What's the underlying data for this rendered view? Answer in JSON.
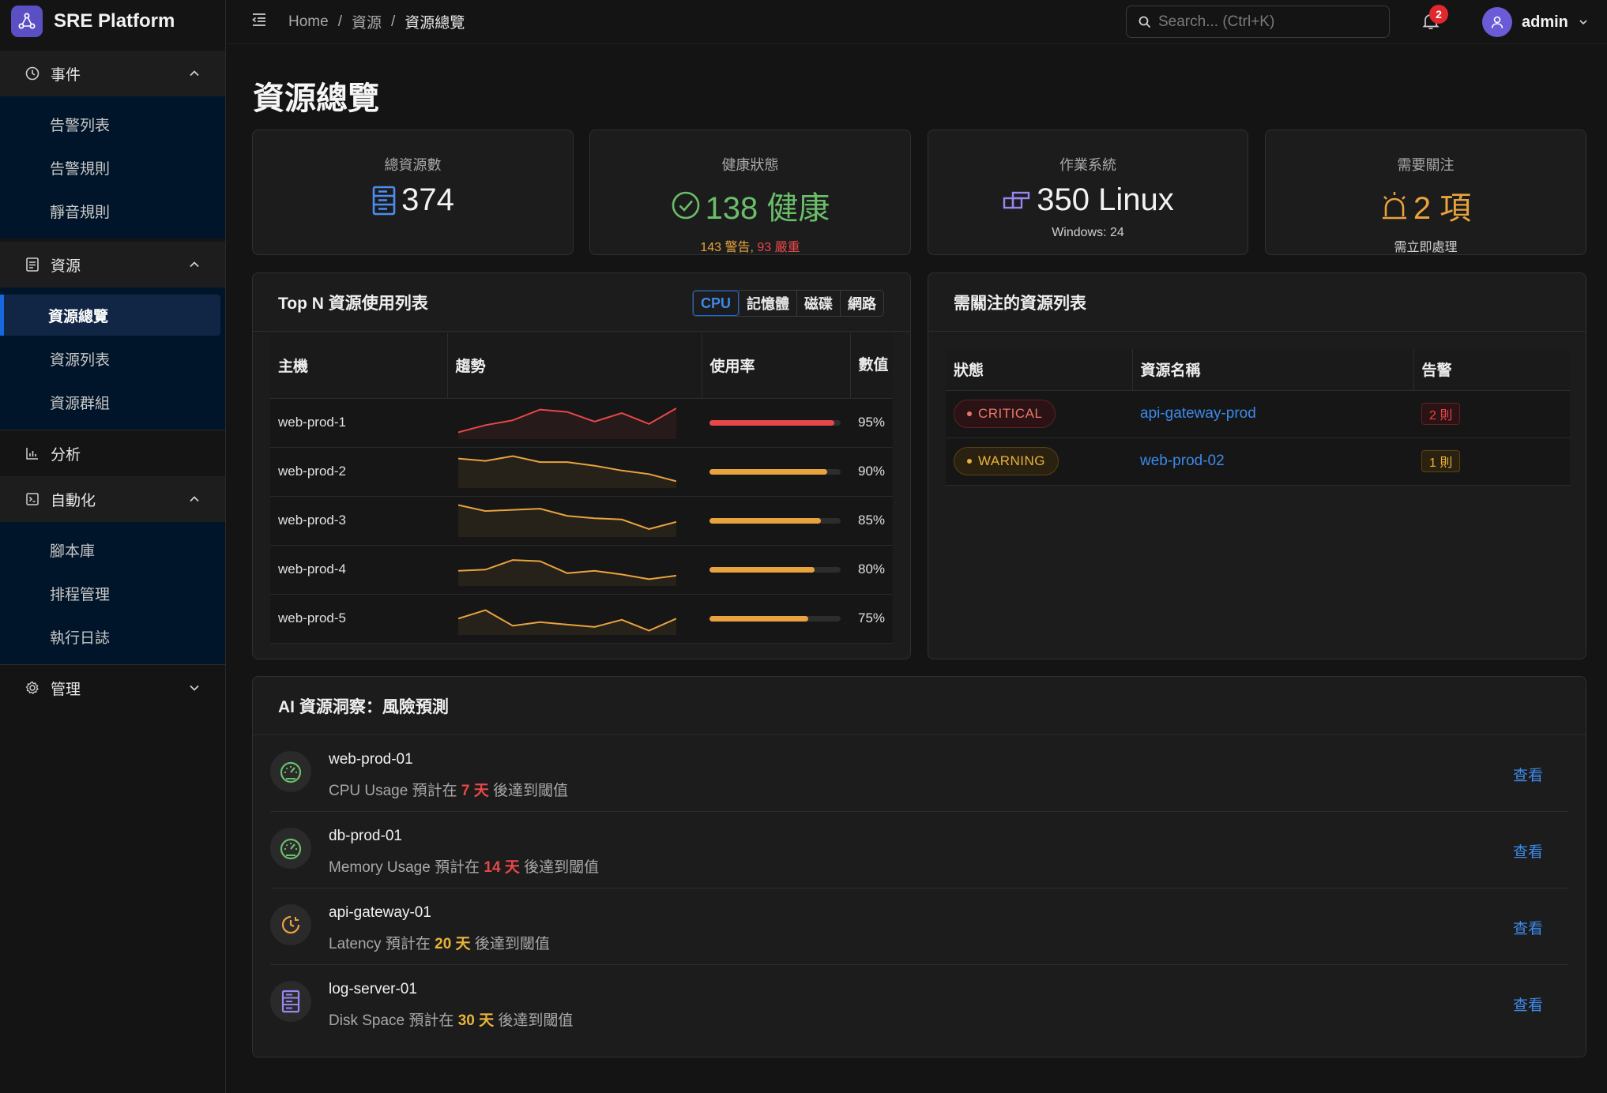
{
  "brand": {
    "name": "SRE Platform"
  },
  "sidebar": {
    "groups": [
      {
        "label": "事件",
        "items": [
          "告警列表",
          "告警規則",
          "靜音規則"
        ]
      },
      {
        "label": "資源",
        "items": [
          "資源總覽",
          "資源列表",
          "資源群組"
        ],
        "active": "資源總覽"
      },
      {
        "label": "分析"
      },
      {
        "label": "自動化",
        "items": [
          "腳本庫",
          "排程管理",
          "執行日誌"
        ]
      },
      {
        "label": "管理"
      }
    ]
  },
  "header": {
    "breadcrumb": [
      "Home",
      "資源",
      "資源總覽"
    ],
    "search_placeholder": "Search... (Ctrl+K)",
    "notification_count": "2",
    "username": "admin"
  },
  "page": {
    "title": "資源總覽"
  },
  "stats": {
    "total": {
      "label": "總資源數",
      "value": "374"
    },
    "health": {
      "label": "健康狀態",
      "value": "138 健康",
      "warn": "143 警告",
      "sep": ",",
      "crit": "93 嚴重"
    },
    "os": {
      "label": "作業系統",
      "value": "350 Linux",
      "sub": "Windows: 24"
    },
    "attention": {
      "label": "需要關注",
      "value": "2 項",
      "sub": "需立即處理"
    }
  },
  "topn": {
    "title": "Top N 資源使用列表",
    "tabs": [
      "CPU",
      "記憶體",
      "磁碟",
      "網路"
    ],
    "active_tab": "CPU",
    "columns": [
      "主機",
      "趨勢",
      "使用率",
      "數值"
    ],
    "rows": [
      {
        "host": "web-prod-1",
        "usage": 95,
        "value": "95%",
        "color": "#e84749",
        "trend": [
          3,
          9,
          13,
          22,
          20,
          12,
          19,
          10,
          23
        ]
      },
      {
        "host": "web-prod-2",
        "usage": 90,
        "value": "90%",
        "color": "#e8a33e",
        "trend": [
          22,
          20,
          24,
          19,
          19,
          16,
          12,
          9,
          3
        ]
      },
      {
        "host": "web-prod-3",
        "usage": 85,
        "value": "85%",
        "color": "#e8a33e",
        "trend": [
          24,
          19,
          20,
          21,
          15,
          13,
          12,
          4,
          10
        ]
      },
      {
        "host": "web-prod-4",
        "usage": 80,
        "value": "80%",
        "color": "#e8a33e",
        "trend": [
          10,
          11,
          19,
          18,
          8,
          10,
          7,
          3,
          6
        ]
      },
      {
        "host": "web-prod-5",
        "usage": 75,
        "value": "75%",
        "color": "#e8a33e",
        "trend": [
          11,
          18,
          5,
          8,
          6,
          4,
          10,
          1,
          11
        ]
      }
    ]
  },
  "attention_list": {
    "title": "需關注的資源列表",
    "columns": [
      "狀態",
      "資源名稱",
      "告警"
    ],
    "rows": [
      {
        "status": "CRITICAL",
        "name": "api-gateway-prod",
        "alerts": "2 則"
      },
      {
        "status": "WARNING",
        "name": "web-prod-02",
        "alerts": "1 則"
      }
    ]
  },
  "ai": {
    "title": "AI 資源洞察：風險預測",
    "items": [
      {
        "host": "web-prod-01",
        "metric": "CPU Usage",
        "pre": "預計在",
        "days": "7 天",
        "post": "後達到閾值",
        "icon": "gauge-icon",
        "link": "查看"
      },
      {
        "host": "db-prod-01",
        "metric": "Memory Usage",
        "pre": "預計在",
        "days": "14 天",
        "post": "後達到閾值",
        "icon": "gauge-icon",
        "link": "查看"
      },
      {
        "host": "api-gateway-01",
        "metric": "Latency",
        "pre": "預計在",
        "days": "20 天",
        "post": "後達到閾值",
        "icon": "clock-history-icon",
        "link": "查看"
      },
      {
        "host": "log-server-01",
        "metric": "Disk Space",
        "pre": "預計在",
        "days": "30 天",
        "post": "後達到閾值",
        "icon": "server-icon",
        "link": "查看"
      }
    ]
  }
}
